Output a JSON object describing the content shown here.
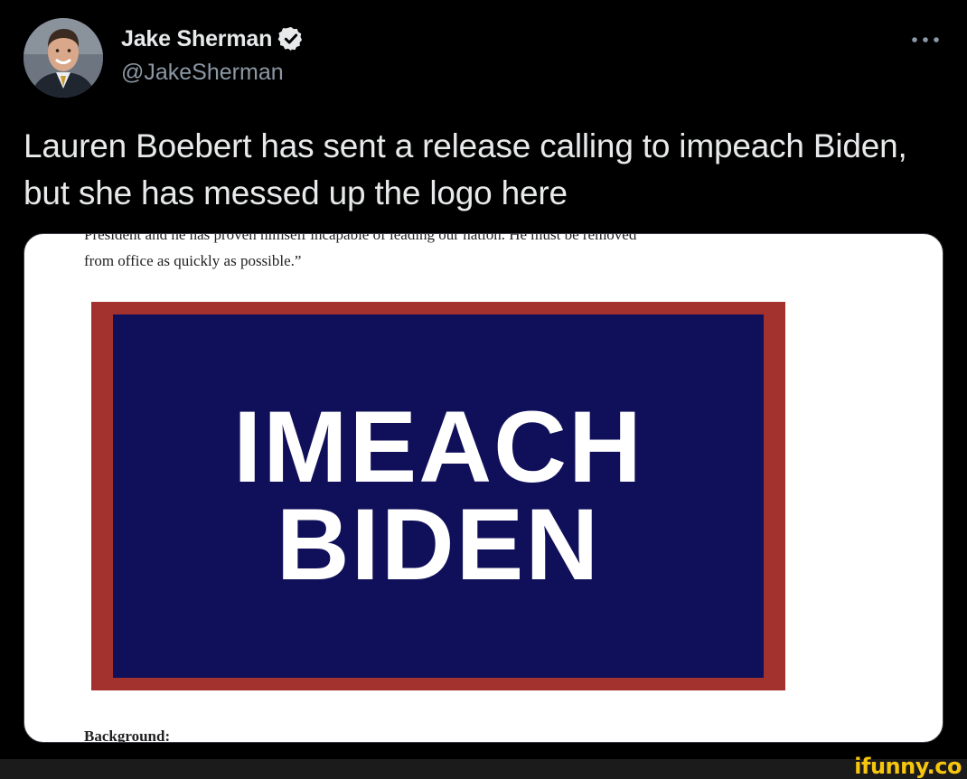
{
  "author": {
    "display_name": "Jake Sherman",
    "handle": "@JakeSherman",
    "verified": true,
    "avatar_icon": "profile-photo"
  },
  "menu": {
    "icon": "more-horizontal-icon"
  },
  "tweet": {
    "text": "Lauren Boebert has sent a release calling to impeach Biden, but she has messed up the logo here"
  },
  "media": {
    "doc_cut_top": "President and he has proven himself incapable of leading our nation. He must be removed",
    "doc_line": "from office as quickly as possible.”",
    "logo_line_1": "IMEACH",
    "logo_line_2": "BIDEN",
    "doc_cut_bottom": "Background:"
  },
  "watermark": "ifunny.co",
  "colors": {
    "background": "#000000",
    "text": "#e7e9ea",
    "handle": "#8b98a5",
    "verified": "#e7e9ea",
    "logo_border": "#a3322f",
    "logo_field": "#100f5a",
    "watermark": "#f6c50d"
  }
}
